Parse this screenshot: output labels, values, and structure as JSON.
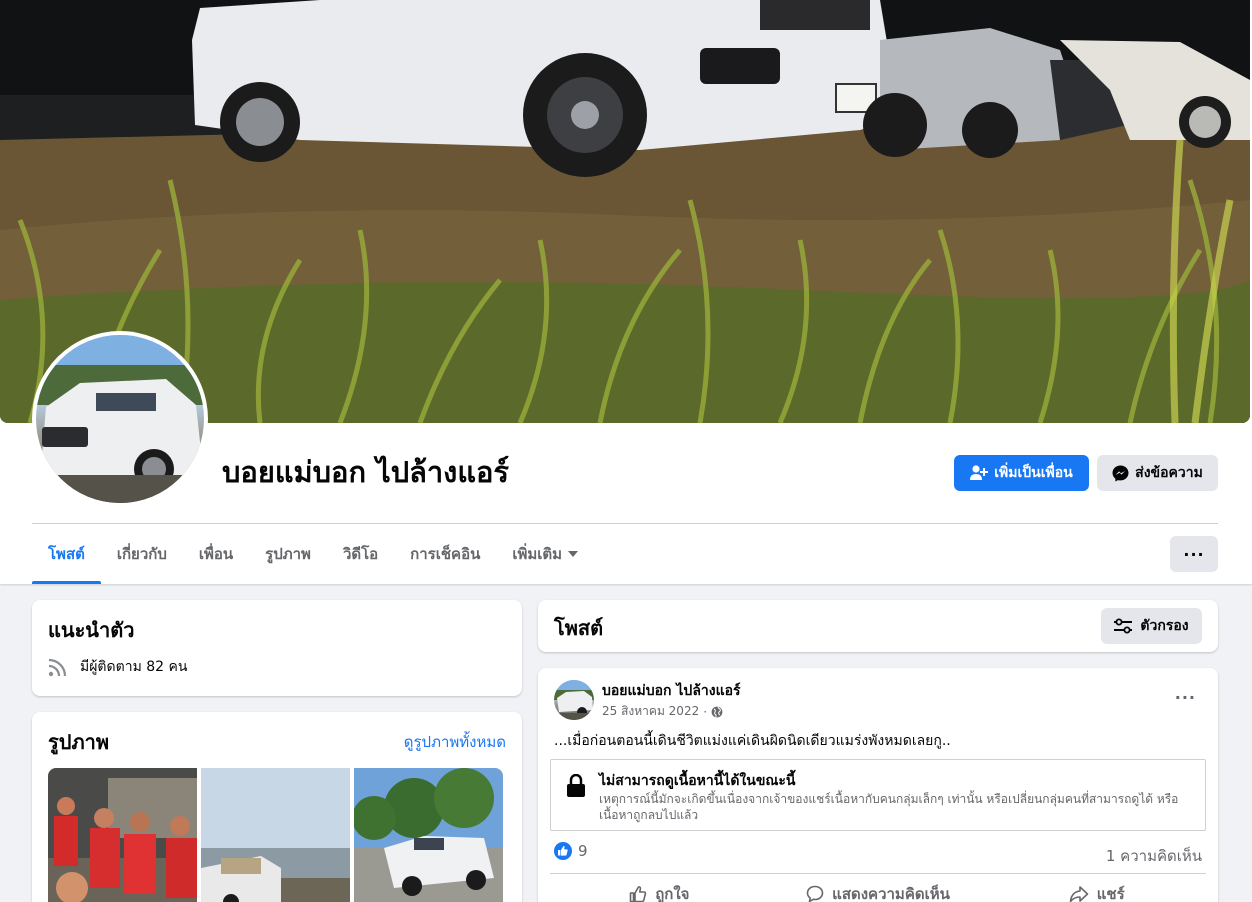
{
  "profile": {
    "name": "บอยแม่บอก ไปล้างแอร์",
    "add_friend_label": "เพิ่มเป็นเพื่อน",
    "message_label": "ส่งข้อความ"
  },
  "tabs": [
    {
      "label": "โพสต์",
      "active": true
    },
    {
      "label": "เกี่ยวกับ"
    },
    {
      "label": "เพื่อน"
    },
    {
      "label": "รูปภาพ"
    },
    {
      "label": "วิดีโอ"
    },
    {
      "label": "การเช็คอิน"
    },
    {
      "label": "เพิ่มเติม"
    }
  ],
  "more_menu_label": "···",
  "intro": {
    "title": "แนะนำตัว",
    "followers_text": "มีผู้ติดตาม 82 คน"
  },
  "photos": {
    "title": "รูปภาพ",
    "see_all": "ดูรูปภาพทั้งหมด"
  },
  "posts": {
    "title": "โพสต์",
    "filter_label": "ตัวกรอง"
  },
  "post": {
    "author": "บอยแม่บอก ไปล้างแอร์",
    "date": "25 สิงหาคม 2022",
    "separator": "·",
    "text": "...เมื่อก่อนตอนนี้เดินชีวิตแม่งแค่เดินผิดนิดเดียวแมร่งพังหมดเลยกู..",
    "options_label": "···",
    "unavailable_title": "ไม่สามารถดูเนื้อหานี้ได้ในขณะนี้",
    "unavailable_desc": "เหตุการณ์นี้มักจะเกิดขึ้นเนื่องจากเจ้าของแชร์เนื้อหากับคนกลุ่มเล็กๆ เท่านั้น หรือเปลี่ยนกลุ่มคนที่สามารถดูได้ หรือเนื้อหาถูกลบไปแล้ว",
    "likes": "9",
    "comments": "1 ความคิดเห็น",
    "like_label": "ถูกใจ",
    "comment_label": "แสดงความคิดเห็น",
    "share_label": "แชร์"
  },
  "colors": {
    "brand": "#1877f2",
    "background": "#f0f2f5",
    "secondary_button": "#e4e6eb",
    "muted_text": "#65676b"
  },
  "icons": [
    "add-friend-icon",
    "messenger-icon",
    "chevron-down-icon",
    "rss-icon",
    "filter-icon",
    "globe-icon",
    "lock-icon",
    "like-icon",
    "comment-icon",
    "share-icon"
  ]
}
